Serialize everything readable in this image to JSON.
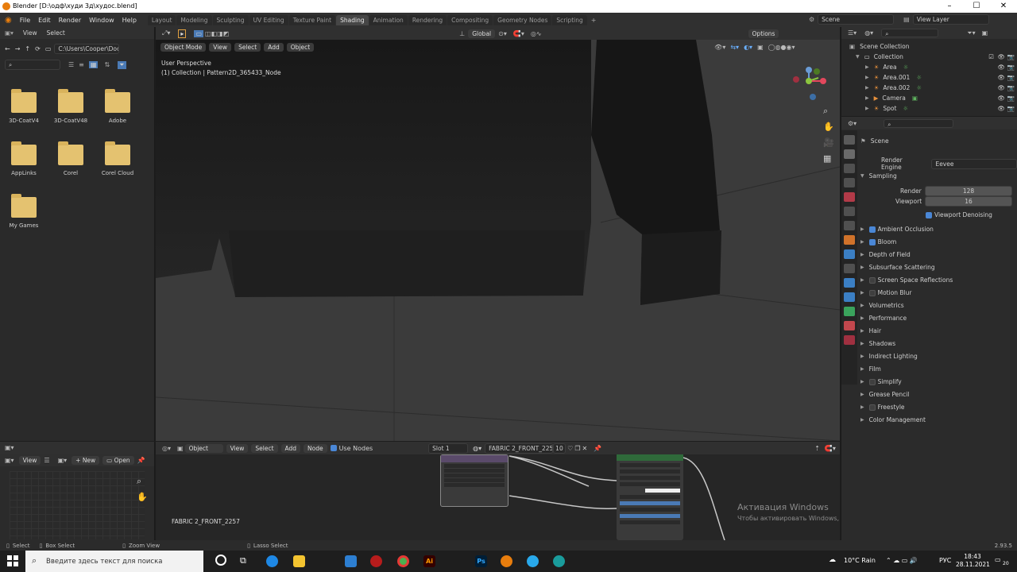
{
  "window": {
    "title": "Blender [D:\\одф\\худи 3д\\худос.blend]"
  },
  "topmenu": {
    "items": [
      "File",
      "Edit",
      "Render",
      "Window",
      "Help"
    ]
  },
  "workspaces": [
    "Layout",
    "Modeling",
    "Sculpting",
    "UV Editing",
    "Texture Paint",
    "Shading",
    "Animation",
    "Rendering",
    "Compositing",
    "Geometry Nodes",
    "Scripting"
  ],
  "active_workspace": "Shading",
  "scene": {
    "scene_name": "Scene",
    "view_layer": "View Layer"
  },
  "filebrowser": {
    "menu": [
      "View",
      "Select"
    ],
    "path": "C:\\Users\\Cooper\\Docu...",
    "folders": [
      "3D-CoatV4",
      "3D-CoatV48",
      "Adobe",
      "AppLinks",
      "Corel",
      "Corel Cloud",
      "My Games"
    ]
  },
  "viewport_toolbar": {
    "orientation": "Global",
    "options": "Options"
  },
  "viewport": {
    "mode": "Object Mode",
    "menu": [
      "View",
      "Select",
      "Add",
      "Object"
    ],
    "info_line1": "User Perspective",
    "info_line2": "(1) Collection | Pattern2D_365433_Node"
  },
  "outliner": {
    "root": "Scene Collection",
    "collection": "Collection",
    "items": [
      "Area",
      "Area.001",
      "Area.002",
      "Camera",
      "Spot"
    ]
  },
  "properties": {
    "context": "Scene",
    "render_engine_label": "Render Engine",
    "render_engine": "Eevee",
    "sampling": "Sampling",
    "render_label": "Render",
    "render_value": "128",
    "viewport_label": "Viewport",
    "viewport_value": "16",
    "viewport_denoising": "Viewport Denoising",
    "panels": [
      {
        "label": "Ambient Occlusion",
        "checkbox": true,
        "checked": true
      },
      {
        "label": "Bloom",
        "checkbox": true,
        "checked": true
      },
      {
        "label": "Depth of Field",
        "checkbox": false,
        "checked": false
      },
      {
        "label": "Subsurface Scattering",
        "checkbox": false,
        "checked": false
      },
      {
        "label": "Screen Space Reflections",
        "checkbox": true,
        "checked": false
      },
      {
        "label": "Motion Blur",
        "checkbox": true,
        "checked": false
      },
      {
        "label": "Volumetrics",
        "checkbox": false,
        "checked": false
      },
      {
        "label": "Performance",
        "checkbox": false,
        "checked": false
      },
      {
        "label": "Hair",
        "checkbox": false,
        "checked": false
      },
      {
        "label": "Shadows",
        "checkbox": false,
        "checked": false
      },
      {
        "label": "Indirect Lighting",
        "checkbox": false,
        "checked": false
      },
      {
        "label": "Film",
        "checkbox": false,
        "checked": false
      },
      {
        "label": "Simplify",
        "checkbox": true,
        "checked": false
      },
      {
        "label": "Grease Pencil",
        "checkbox": false,
        "checked": false
      },
      {
        "label": "Freestyle",
        "checkbox": true,
        "checked": false
      },
      {
        "label": "Color Management",
        "checkbox": false,
        "checked": false
      }
    ]
  },
  "image_editor": {
    "view": "View",
    "new": "New",
    "open": "Open"
  },
  "node_editor": {
    "type": "Object",
    "menu": [
      "View",
      "Select",
      "Add",
      "Node"
    ],
    "use_nodes": "Use Nodes",
    "slot": "Slot 1",
    "material": "FABRIC 2_FRONT_2257",
    "users": "10",
    "label": "FABRIC 2_FRONT_2257"
  },
  "watermark": {
    "title": "Активация Windows",
    "text": "Чтобы активировать Windows, перейдите в раздел \"Параметры\"."
  },
  "statusbar": {
    "items": [
      "Select",
      "Box Select",
      "Zoom View",
      "Lasso Select"
    ],
    "version": "2.93.5"
  },
  "taskbar": {
    "search_placeholder": "Введите здесь текст для поиска",
    "weather": "10°C Rain",
    "lang": "РУС",
    "time": "18:43",
    "date": "28.11.2021",
    "notifications": "20"
  }
}
